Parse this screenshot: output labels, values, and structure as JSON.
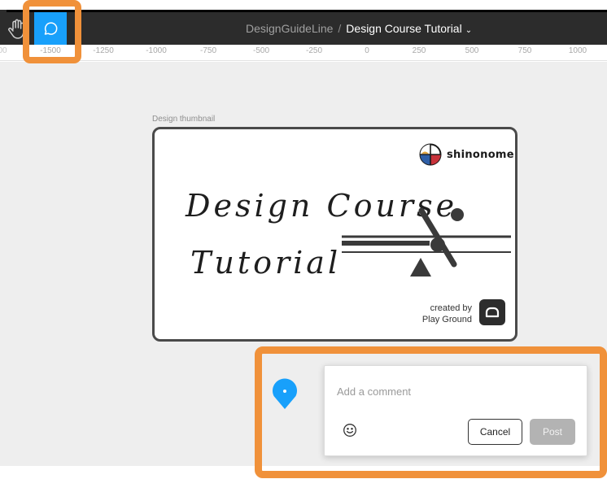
{
  "toolbar": {
    "hand_tool_icon": "hand-icon",
    "comment_tool_icon": "comment-icon",
    "comment_tool_active_color": "#18a0fb",
    "highlight_color": "#f0913a"
  },
  "header": {
    "project": "DesignGuideLine",
    "separator": "/",
    "file_name": "Design Course Tutorial",
    "file_chevron": "⌄"
  },
  "ruler": {
    "ticks": [
      "-1500",
      "-1250",
      "-1000",
      "-750",
      "-500",
      "-250",
      "0",
      "250",
      "500",
      "750",
      "1000"
    ]
  },
  "canvas": {
    "frame_label": "Design thumbnail",
    "thumbnail": {
      "brand": "shinonome",
      "headline_line1": "Design Course",
      "headline_line2": "Tutorial",
      "credit_line1": "created by",
      "credit_line2": "Play Ground"
    }
  },
  "comment": {
    "placeholder": "Add a comment",
    "value": "",
    "emoji_icon": "smiley-icon",
    "cancel_label": "Cancel",
    "post_label": "Post"
  }
}
